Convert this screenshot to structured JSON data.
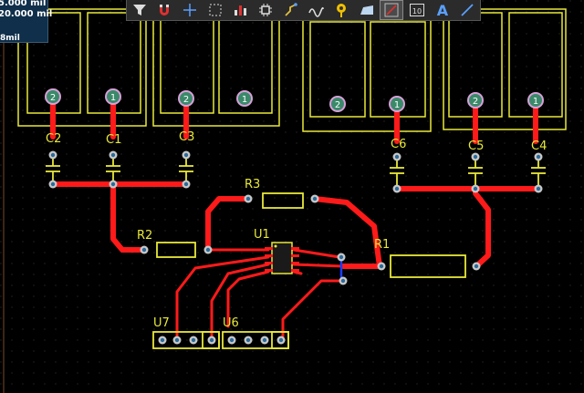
{
  "coords": {
    "line1": "5.000 mil",
    "line2": "20.000 mil",
    "line3": "8mil"
  },
  "toolbar": {
    "tools": [
      {
        "name": "filter-tool",
        "icon": "filter-icon"
      },
      {
        "name": "highlight-net-tool",
        "icon": "magnet-icon"
      },
      {
        "name": "crosshair-tool",
        "icon": "crosshair-icon"
      },
      {
        "name": "select-rect-tool",
        "icon": "select-rect-icon"
      },
      {
        "name": "chart-tool",
        "icon": "bar-chart-icon"
      },
      {
        "name": "component-tool",
        "icon": "chip-icon"
      },
      {
        "name": "route-track-tool",
        "icon": "route-icon"
      },
      {
        "name": "diff-pair-tool",
        "icon": "wave-icon"
      },
      {
        "name": "via-tool",
        "icon": "via-icon"
      },
      {
        "name": "fill-tool",
        "icon": "polygon-fill-icon"
      },
      {
        "name": "interactive-route-tool",
        "icon": "route-active-icon"
      },
      {
        "name": "string-tool",
        "icon": "counter-icon"
      },
      {
        "name": "text-tool",
        "icon": "text-icon"
      },
      {
        "name": "line-tool",
        "icon": "line-icon"
      }
    ],
    "counter_label": "10",
    "text_label": "A"
  },
  "colors": {
    "background": "#000000",
    "track": "#ff1a1a",
    "silkscreen": "#e8e83a",
    "pad": "#c8c8c8",
    "pad_hole": "#2a6a9a",
    "via_ring": "#ff7dff",
    "blue_track": "#1a3cff",
    "grid_dot": "#3a3a3a"
  },
  "components": {
    "C1": "C1",
    "C2": "C2",
    "C3": "C3",
    "C4": "C4",
    "C5": "C5",
    "C6": "C6",
    "R1": "R1",
    "R2": "R2",
    "R3": "R3",
    "U1": "U1",
    "U6": "U6",
    "U7": "U7"
  },
  "pad_numbers": {
    "p1": "2",
    "p2": "1",
    "p3": "2",
    "p4": "1",
    "p5": "2",
    "p6": "1",
    "p7": "2",
    "p8": "1"
  }
}
